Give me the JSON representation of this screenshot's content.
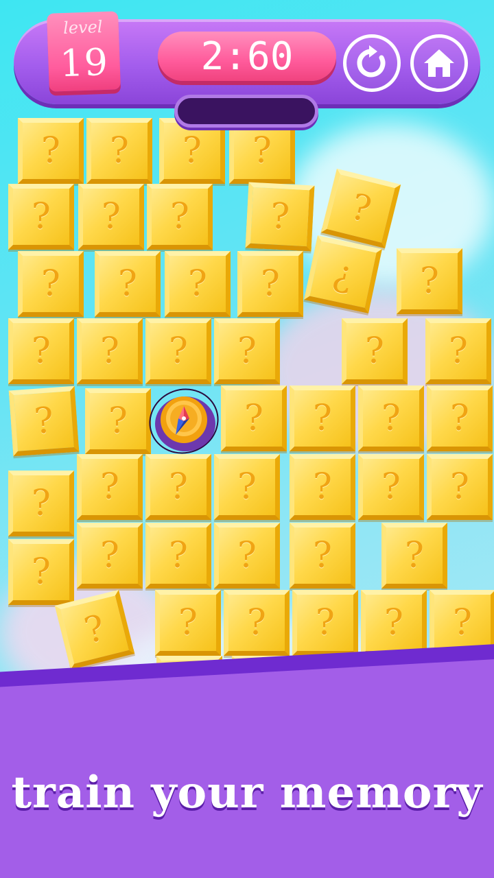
{
  "game": {
    "level_label": "level",
    "level_number": "19",
    "timer": "2:60",
    "restart_icon": "restart-icon",
    "home_icon": "home-icon",
    "tile_symbol": "?",
    "tile_symbol_inverted": "¿"
  },
  "footer": {
    "tagline": "train your memory"
  },
  "colors": {
    "header": "#a35ded",
    "level_badge": "#ff5c9d",
    "timer": "#ff5b9b",
    "tile": "#ffd84a",
    "tile_symbol": "#f0a414",
    "footer": "#a35ee8",
    "sky": "#3ee6f2"
  }
}
